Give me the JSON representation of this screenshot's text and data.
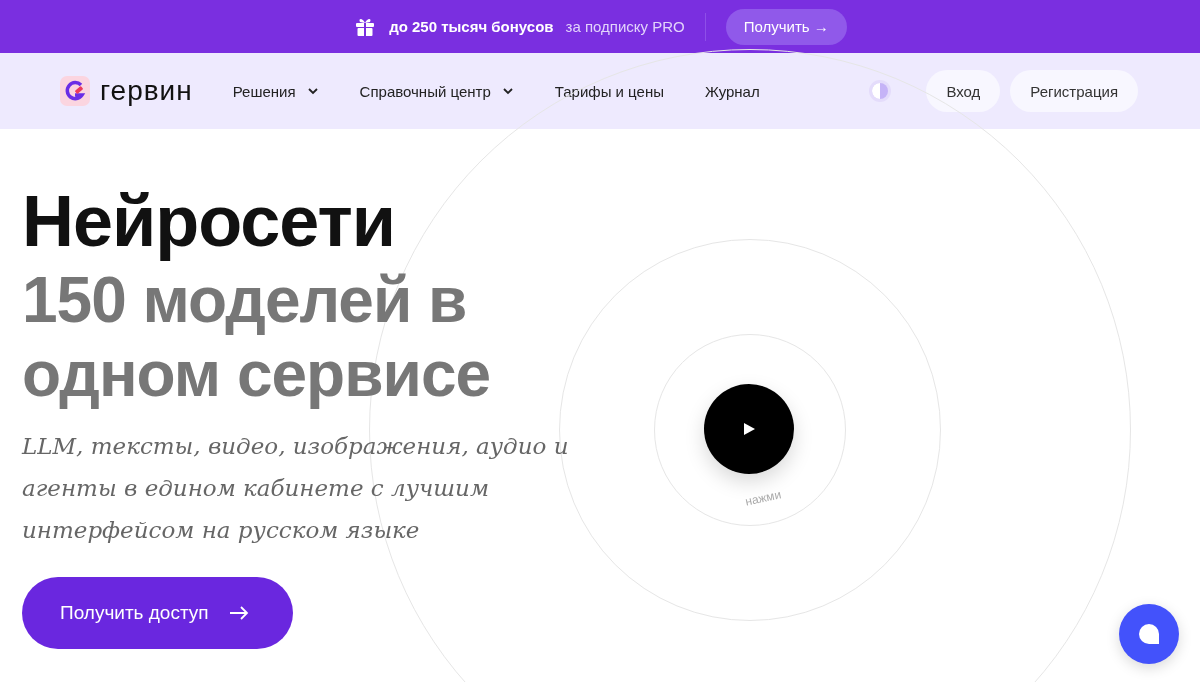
{
  "promo_bar": {
    "highlight": "до 250 тысяч бонусов",
    "text": "за подписку PRO",
    "button": "Получить →"
  },
  "header": {
    "logo": "гервин",
    "nav": [
      {
        "label": "Решения",
        "dropdown": true
      },
      {
        "label": "Справочный центр",
        "dropdown": true
      },
      {
        "label": "Тарифы и цены",
        "dropdown": false
      },
      {
        "label": "Журнал",
        "dropdown": false
      }
    ],
    "buttons": [
      "Вход",
      "Регистрация"
    ]
  },
  "hero": {
    "title": "Нейросети",
    "subtitle": "150 моделей в одном сервисе",
    "tagline": "LLM, тексты, видео, изображения, аудио и агенты в едином кабинете с лучшим интерфейсом на русском языке",
    "cta": "Получить доступ",
    "play_hint": "нажми"
  }
}
